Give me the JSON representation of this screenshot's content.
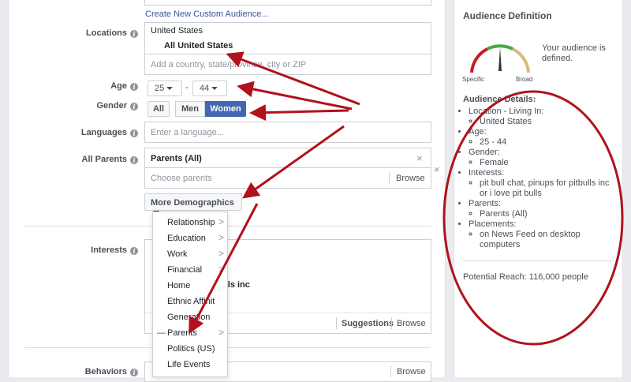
{
  "colors": {
    "accent": "#4267b2",
    "link": "#365899",
    "annotation": "#b0121b"
  },
  "top_link": "Create New Custom Audience...",
  "locations": {
    "label": "Locations",
    "country": "United States",
    "selected": "All United States",
    "placeholder": "Add a country, state/province, city or ZIP"
  },
  "age": {
    "label": "Age",
    "min": "25",
    "dash": "-",
    "max": "44"
  },
  "gender": {
    "label": "Gender",
    "options": [
      "All",
      "Men",
      "Women"
    ],
    "selected": "Women"
  },
  "languages": {
    "label": "Languages",
    "placeholder": "Enter a language..."
  },
  "all_parents": {
    "label": "All Parents",
    "tag": "Parents (All)",
    "remove": "×",
    "placeholder": "Choose parents",
    "browse": "Browse",
    "close": "×"
  },
  "more_demographics": {
    "label": "More Demographics",
    "menu": [
      {
        "label": "Relationship",
        "chevron": ">"
      },
      {
        "label": "Education",
        "chevron": ">"
      },
      {
        "label": "Work",
        "chevron": ">"
      },
      {
        "label": "Financial",
        "chevron": ">"
      },
      {
        "label": "Home",
        "chevron": ""
      },
      {
        "label": "Ethnic Affinity",
        "chevron": ""
      },
      {
        "label": "Generation",
        "chevron": ""
      },
      {
        "label": "Parents",
        "chevron": ">",
        "prefix": "—"
      },
      {
        "label": "Politics (US)",
        "chevron": ""
      },
      {
        "label": "Life Events",
        "chevron": ""
      }
    ]
  },
  "interests": {
    "label": "Interests",
    "partial_text": "ulls inc",
    "suggestions": "Suggestions",
    "browse": "Browse"
  },
  "behaviors": {
    "label": "Behaviors",
    "browse": "Browse"
  },
  "audience_definition": {
    "title": "Audience Definition",
    "status": "Your audience is defined.",
    "gauge_left": "Specific",
    "gauge_right": "Broad",
    "details_title": "Audience Details:",
    "details": [
      {
        "heading": "Location - Living In:",
        "items": [
          "United States"
        ]
      },
      {
        "heading": "Age:",
        "items": [
          "25 - 44"
        ]
      },
      {
        "heading": "Gender:",
        "items": [
          "Female"
        ]
      },
      {
        "heading": "Interests:",
        "items": [
          "pit bull chat, pinups for pitbulls inc or i love pit bulls"
        ]
      },
      {
        "heading": "Parents:",
        "items": [
          "Parents (All)"
        ]
      },
      {
        "heading": "Placements:",
        "items": [
          "on News Feed on desktop computers"
        ]
      }
    ],
    "potential_reach": "Potential Reach: 116,000 people"
  }
}
